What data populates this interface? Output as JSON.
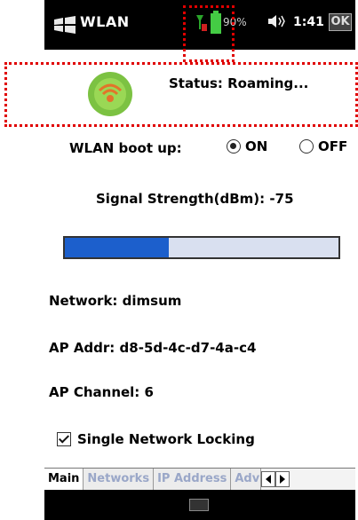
{
  "titlebar": {
    "title": "WLAN",
    "battery_percent": "90%",
    "time": "1:41",
    "close_label": "OK",
    "icons": [
      "windows-logo-icon",
      "signal-icon",
      "battery-icon",
      "speaker-icon",
      "close-icon"
    ]
  },
  "status": {
    "text": "Status: Roaming...",
    "icon": "wifi-status-icon",
    "color": "#7cc242"
  },
  "boot": {
    "label": "WLAN boot up:",
    "on_label": "ON",
    "off_label": "OFF",
    "selected": "ON"
  },
  "signal": {
    "label": "Signal Strength(dBm):",
    "value": "-75",
    "progress": 0.38
  },
  "info": {
    "network_label": "Network:",
    "network_value": "dimsum",
    "ap_addr_label": "AP Addr:",
    "ap_addr_value": "d8-5d-4c-d7-4a-c4",
    "ap_channel_label": "AP Channel:",
    "ap_channel_value": "6"
  },
  "locking": {
    "label": "Single Network Locking",
    "checked": true
  },
  "tabs": [
    {
      "label": "Main",
      "active": true
    },
    {
      "label": "Networks",
      "active": false
    },
    {
      "label": "IP Address",
      "active": false
    },
    {
      "label": "Adv",
      "active": false
    }
  ],
  "colors": {
    "accent": "#1c5fcc",
    "callout": "#e00000"
  }
}
